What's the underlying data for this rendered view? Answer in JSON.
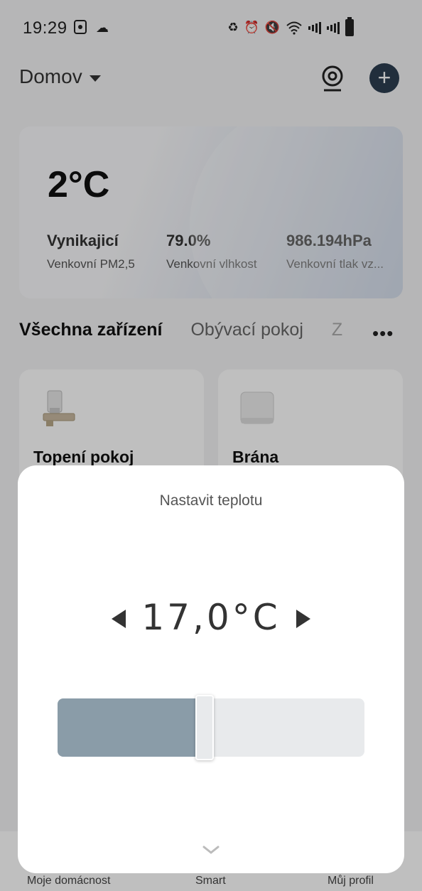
{
  "status_bar": {
    "time": "19:29",
    "icons": [
      "notification-icon",
      "weather-icon",
      "battery-saver-icon",
      "alarm-icon",
      "mute-icon",
      "wifi-icon",
      "signal-icon",
      "signal-icon",
      "battery-icon"
    ]
  },
  "header": {
    "home_title": "Domov"
  },
  "weather": {
    "temperature": "2°C",
    "metrics": [
      {
        "value": "Vynikajicí",
        "label": "Venkovní PM2,5"
      },
      {
        "value": "79.0%",
        "label": "Venkovní vlhkost"
      },
      {
        "value": "986.194hPa",
        "label": "Venkovní tlak vz..."
      }
    ]
  },
  "tabs": [
    {
      "label": "Všechna zařízení",
      "active": true
    },
    {
      "label": "Obývací pokoj",
      "active": false
    },
    {
      "label": "Z",
      "active": false
    }
  ],
  "more_label": "•••",
  "devices": [
    {
      "name": "Topení pokoj",
      "icon": "radiator-valve-icon"
    },
    {
      "name": "Brána",
      "icon": "gateway-icon"
    }
  ],
  "bottom_nav": [
    {
      "label": "Moje domácnost"
    },
    {
      "label": "Smart"
    },
    {
      "label": "Můj profil"
    }
  ],
  "dialog": {
    "title": "Nastavit teplotu",
    "temperature": "17,0°C",
    "slider_fraction": 0.48
  },
  "colors": {
    "accent": "#2c3e50",
    "slider_fill": "#8a9ca8",
    "slider_track": "#e8eaec"
  }
}
